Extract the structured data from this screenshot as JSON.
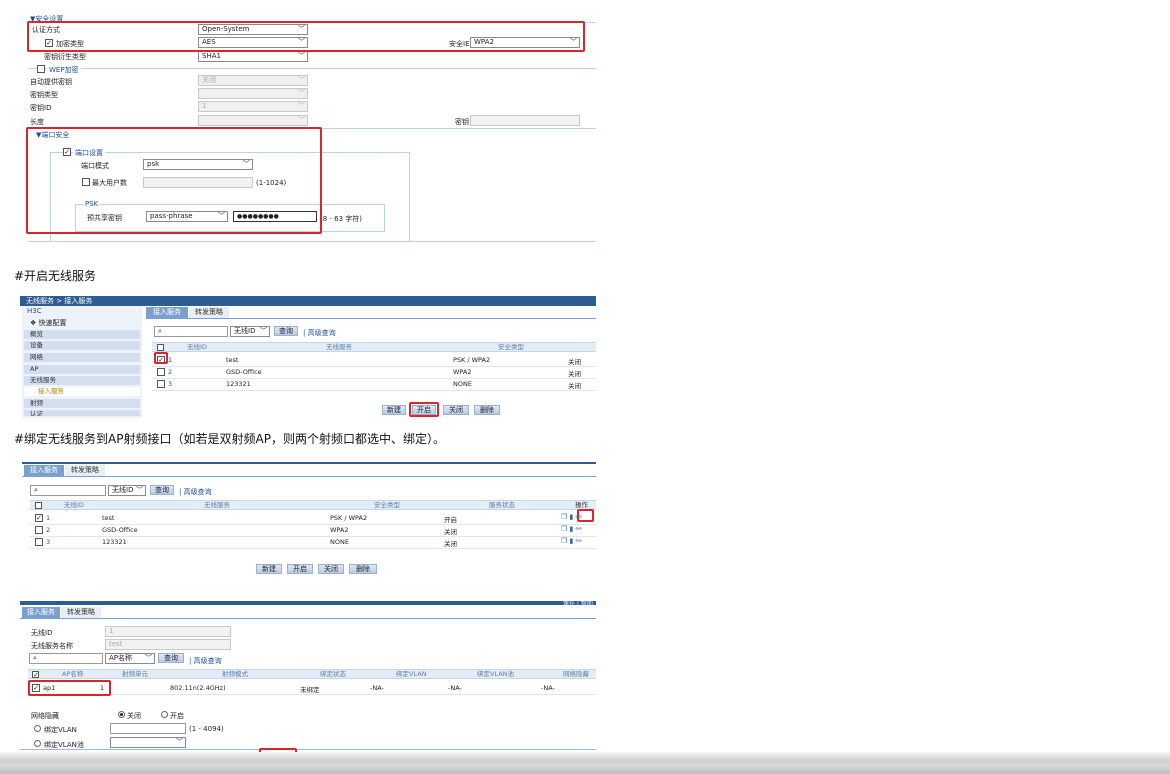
{
  "section1": {
    "security_title": "▼安全设置",
    "auth_label": "认证方式",
    "auth_value": "Open-System",
    "enc_label": "加密类型",
    "enc_value": "AES",
    "ie_label": "安全IE",
    "ie_value": "WPA2",
    "key_derive_label": "密钥衍生类型",
    "key_derive_value": "SHA1",
    "wep_label": "WEP加密",
    "auto_key_label": "自动提供密钥",
    "auto_key_value": "关闭",
    "key_type_label": "密钥类型",
    "key_id_label": "密钥ID",
    "key_id_value": "1",
    "length_label": "长度",
    "key_label": "密钥",
    "port_security_title": "▼端口安全",
    "port_settings_label": "端口设置",
    "port_mode_label": "端口模式",
    "port_mode_value": "psk",
    "max_users_label": "最大用户数",
    "max_users_range": "(1-1024)",
    "psk_group": "PSK",
    "preshared_label": "预共享密钥",
    "preshared_type": "pass-phrase",
    "preshared_value": "●●●●●●●●",
    "preshared_range": "(8 - 63 字符)"
  },
  "heading1": "#开启无线服务",
  "section2": {
    "breadcrumb": "无线服务 > 接入服务",
    "brand": "H3C",
    "side_quick": "❖ 快速配置",
    "sidebar": [
      "概览",
      "设备",
      "网络",
      "AP",
      "无线服务"
    ],
    "side_sub": "接入服务",
    "sidebar_after": [
      "射频",
      "认证"
    ],
    "tabs": [
      "接入服务",
      "转发策略"
    ],
    "search_field": "无线ID",
    "search_btn": "查询",
    "advanced": "高级查询",
    "headers": [
      "无线ID",
      "无线服务",
      "安全类型"
    ],
    "rows": [
      {
        "id": "1",
        "name": "test",
        "sec": "PSK / WPA2",
        "state": "关闭"
      },
      {
        "id": "2",
        "name": "GSD-Office",
        "sec": "WPA2",
        "state": "关闭"
      },
      {
        "id": "3",
        "name": "123321",
        "sec": "NONE",
        "state": "关闭"
      }
    ],
    "buttons": [
      "新建",
      "开启",
      "关闭",
      "删除"
    ]
  },
  "heading2": "#绑定无线服务到AP射频接口（如若是双射频AP，则两个射频口都选中、绑定）。",
  "section3": {
    "tabs": [
      "接入服务",
      "转发策略"
    ],
    "search_field": "无线ID",
    "search_btn": "查询",
    "advanced": "高级查询",
    "headers": [
      "无线ID",
      "无线服务",
      "安全类型",
      "服务状态",
      "操作"
    ],
    "rows": [
      {
        "id": "1",
        "name": "test",
        "sec": "PSK / WPA2",
        "state": "开启"
      },
      {
        "id": "2",
        "name": "GSD-Office",
        "sec": "WPA2",
        "state": "关闭"
      },
      {
        "id": "3",
        "name": "123321",
        "sec": "NONE",
        "state": "关闭"
      }
    ],
    "buttons": [
      "新建",
      "开启",
      "关闭",
      "删除"
    ]
  },
  "section4": {
    "tabs": [
      "接入服务",
      "转发策略"
    ],
    "top_right": "保存 | 帮助",
    "wid_label": "无线ID",
    "wid_value": "1",
    "wname_label": "无线服务名称",
    "wname_value": "test",
    "search_field": "AP名称",
    "search_btn": "查询",
    "advanced": "高级查询",
    "headers": [
      "AP名称",
      "射频单元",
      "射频模式",
      "绑定状态",
      "绑定VLAN",
      "绑定VLAN池",
      "网络隐藏"
    ],
    "row": {
      "ap": "ap1",
      "unit": "1",
      "mode": "802.11n(2.4GHz)",
      "state": "未绑定",
      "vlan": "-NA-",
      "pool": "-NA-",
      "hide": "-NA-"
    },
    "net_hide_label": "网络隐藏",
    "off_label": "关闭",
    "on_label": "开启",
    "bind_vlan_label": "绑定VLAN",
    "vlan_range": "(1 - 4094)",
    "bind_pool_label": "绑定VLAN池"
  }
}
